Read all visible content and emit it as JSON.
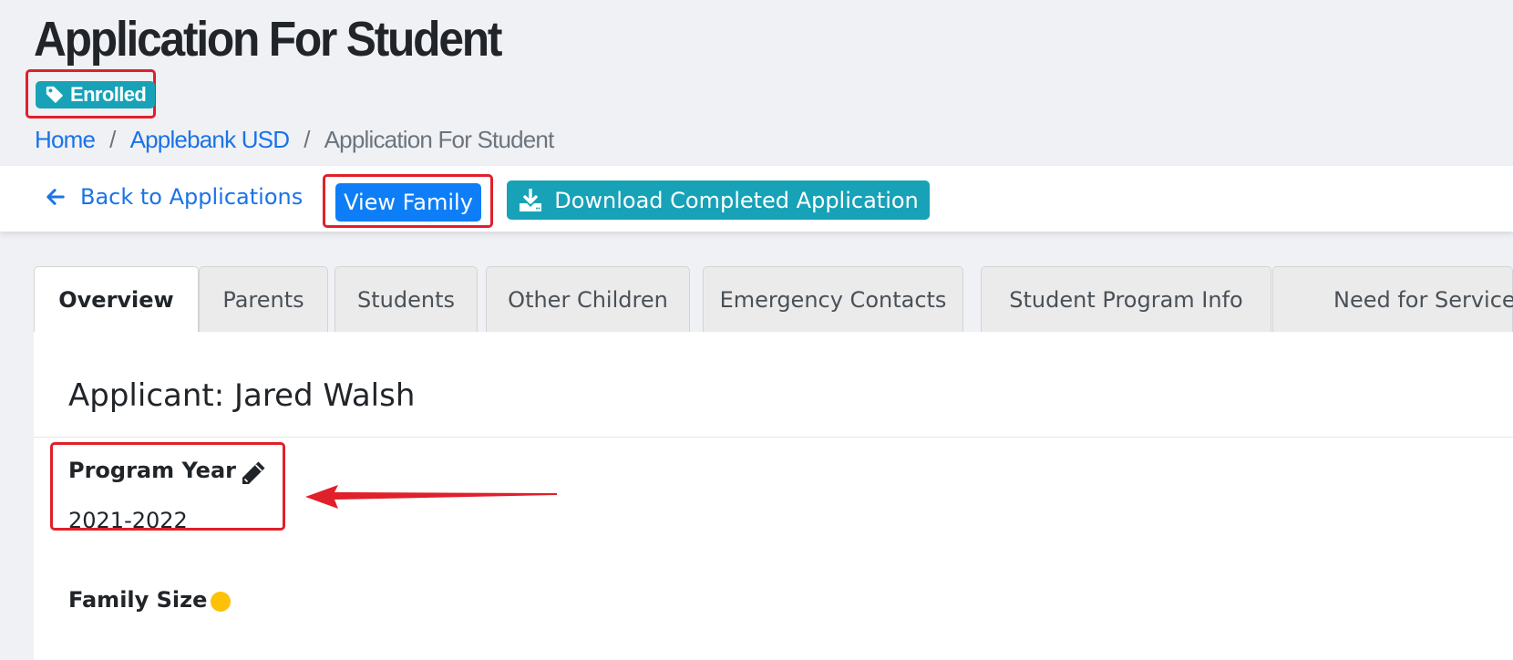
{
  "header": {
    "title": "Application For Student",
    "status_badge": "Enrolled",
    "breadcrumb": {
      "home": "Home",
      "separator": "/",
      "district": "Applebank USD",
      "current": "Application For Student"
    }
  },
  "toolbar": {
    "back_label": "Back to Applications",
    "view_family_label": "View Family",
    "download_label": "Download Completed Application"
  },
  "tabs": [
    {
      "label": "Overview",
      "active": true
    },
    {
      "label": "Parents"
    },
    {
      "label": "Students"
    },
    {
      "label": "Other Children"
    },
    {
      "label": "Emergency Contacts"
    },
    {
      "label": "Student Program Info"
    },
    {
      "label": "Need for Service",
      "indicator": "warning-dot"
    }
  ],
  "overview": {
    "applicant_heading": "Applicant: Jared Walsh",
    "program_year_label": "Program Year",
    "program_year_value": "2021-2022",
    "family_size_label": "Family Size",
    "family_size_indicator": "warning-dot"
  },
  "colors": {
    "primary": "#0d7ef7",
    "info": "#17a2b8",
    "warning": "#ffc107",
    "highlight": "#e0202a",
    "link": "#1a73e8"
  },
  "icons": [
    "tag-icon",
    "arrow-left-icon",
    "download-icon",
    "pencil-icon"
  ]
}
